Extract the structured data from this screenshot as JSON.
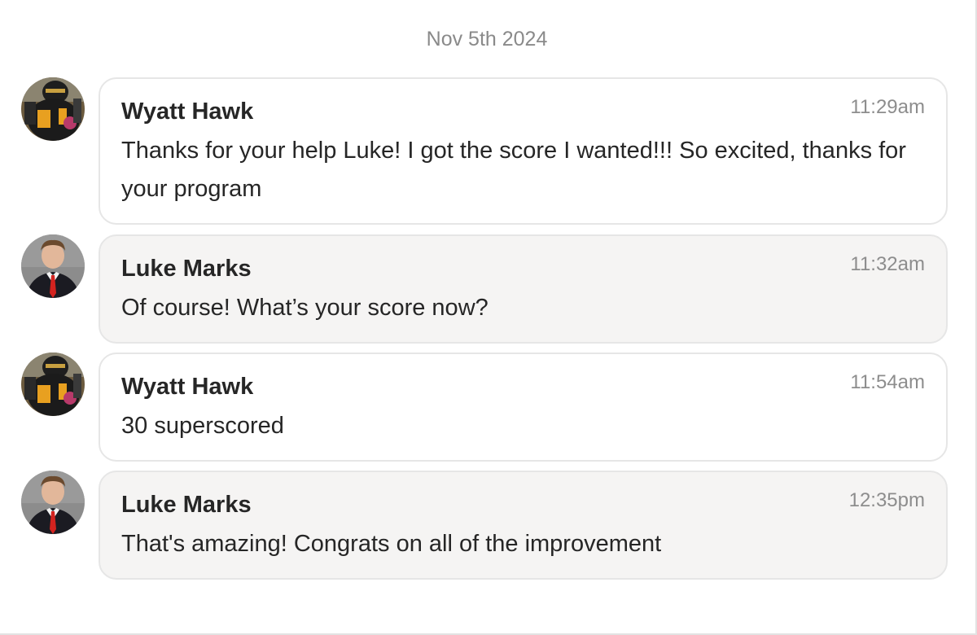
{
  "date_separator": "Nov 5th 2024",
  "messages": [
    {
      "sender": "Wyatt Hawk",
      "time": "11:29am",
      "text": "Thanks for your help Luke! I got the score I wanted!!! So excited, thanks for your program",
      "avatar": "football-player-avatar"
    },
    {
      "sender": "Luke Marks",
      "time": "11:32am",
      "text": "Of course! What’s your score now?",
      "avatar": "suit-portrait-avatar"
    },
    {
      "sender": "Wyatt Hawk",
      "time": "11:54am",
      "text": "30 superscored",
      "avatar": "football-player-avatar"
    },
    {
      "sender": "Luke Marks",
      "time": "12:35pm",
      "text": "That's amazing! Congrats on all of the improvement",
      "avatar": "suit-portrait-avatar"
    }
  ],
  "colors": {
    "bubble_white": "#ffffff",
    "bubble_gray": "#f5f4f3",
    "bubble_border": "#e6e6e6",
    "timestamp": "#8d8d8d",
    "date_separator": "#8a8a8a"
  }
}
